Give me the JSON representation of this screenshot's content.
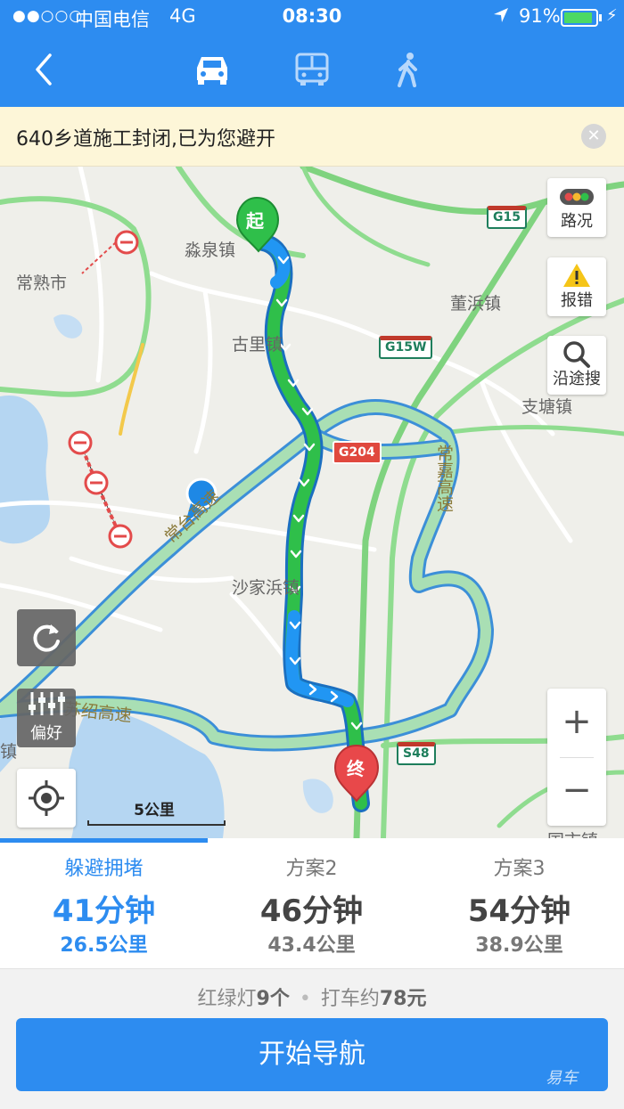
{
  "status_bar": {
    "signal": "●●○○○",
    "carrier": "中国电信",
    "network": "4G",
    "time": "08:30",
    "location_icon": "location-arrow-icon",
    "battery": "91%",
    "battery_level": 0.91
  },
  "header": {
    "back_icon": "back-chevron-icon",
    "modes": [
      {
        "name": "car",
        "icon": "car-icon",
        "active": true
      },
      {
        "name": "bus",
        "icon": "bus-icon",
        "active": false
      },
      {
        "name": "walk",
        "icon": "walk-icon",
        "active": false
      }
    ]
  },
  "notice": {
    "text": "640乡道施工封闭,已为您避开",
    "close_icon": "close-icon"
  },
  "map": {
    "places": [
      "常熟市",
      "淼泉镇",
      "古里镇",
      "董浜镇",
      "支塘镇",
      "沙家浜镇",
      "国市镇",
      "镇"
    ],
    "roads": {
      "g15": "G15",
      "g15w": "G15W",
      "g204": "G204",
      "s48": "S48",
      "changtai": "常台高速",
      "sushao": "苏绍高速",
      "changjia": "常嘉高速"
    },
    "markers": {
      "start": "起",
      "end": "终"
    },
    "buttons": {
      "traffic": "路况",
      "report": "报错",
      "search_along": "沿途搜",
      "preference": "偏好"
    },
    "scale": "5公里",
    "colors": {
      "route_green": "#2fbf4a",
      "route_blue": "#2196f3",
      "alt_route": "#a9dfb4",
      "water": "#b5d6f2",
      "highway": "#8fdc8f"
    }
  },
  "routes": [
    {
      "name": "躲避拥堵",
      "time": "41分钟",
      "distance": "26.5公里",
      "active": true
    },
    {
      "name": "方案2",
      "time": "46分钟",
      "distance": "43.4公里",
      "active": false
    },
    {
      "name": "方案3",
      "time": "54分钟",
      "distance": "38.9公里",
      "active": false
    }
  ],
  "summary": {
    "lights_prefix": "红绿灯",
    "lights_count": "9个",
    "taxi_prefix": "打车约",
    "taxi_price": "78元"
  },
  "start_button": "开始导航",
  "watermark": "易车"
}
